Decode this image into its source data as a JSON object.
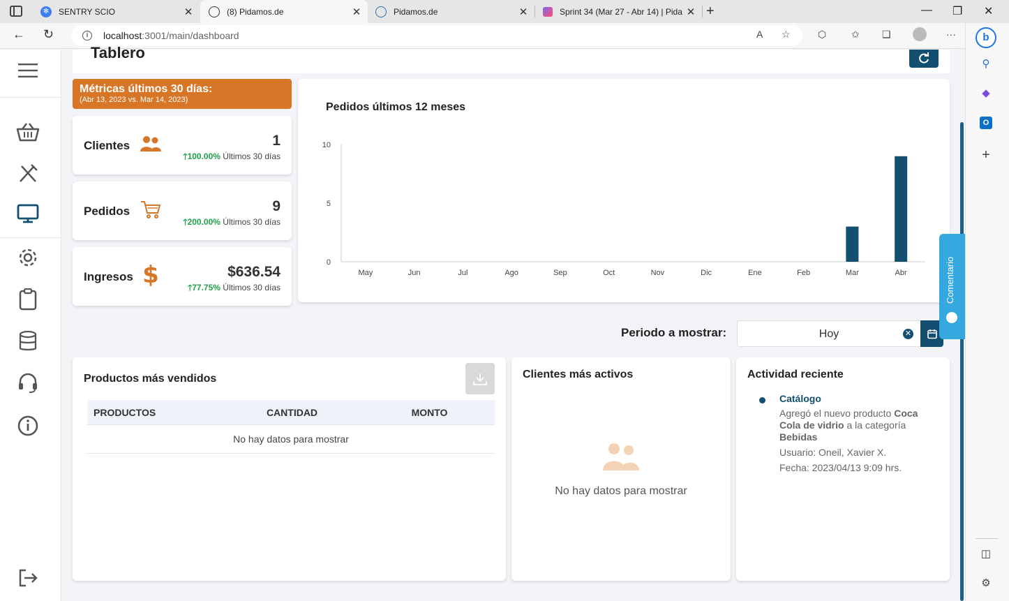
{
  "browser": {
    "tabs": [
      {
        "title": "SENTRY SCIO",
        "favicon": "gear-globe-icon"
      },
      {
        "title": "(8) Pidamos.de",
        "favicon": "pidamos-icon"
      },
      {
        "title": "Pidamos.de",
        "favicon": "pidamos-icon"
      },
      {
        "title": "Sprint 34 (Mar 27 - Abr 14) | Pida",
        "favicon": "clickup-icon"
      }
    ],
    "url_host": "localhost",
    "url_rest": ":3001/main/dashboard"
  },
  "page": {
    "title": "Tablero"
  },
  "metrics": {
    "banner_title": "Métricas últimos 30 días:",
    "banner_range": "(Abr 13, 2023 vs. Mar 14, 2023)",
    "items": [
      {
        "label": "Clientes",
        "value": "1",
        "pct": "100.00%",
        "trend_text": "Últimos 30 días",
        "icon": "users-icon"
      },
      {
        "label": "Pedidos",
        "value": "9",
        "pct": "200.00%",
        "trend_text": "Últimos 30 días",
        "icon": "cart-icon"
      },
      {
        "label": "Ingresos",
        "value": "$636.54",
        "pct": "77.75%",
        "trend_text": "Últimos 30 días",
        "icon": "dollar-icon"
      }
    ]
  },
  "chart_data": {
    "type": "bar",
    "title": "Pedidos últimos 12 meses",
    "categories": [
      "May",
      "Jun",
      "Jul",
      "Ago",
      "Sep",
      "Oct",
      "Nov",
      "Dic",
      "Ene",
      "Feb",
      "Mar",
      "Abr"
    ],
    "values": [
      0,
      0,
      0,
      0,
      0,
      0,
      0,
      0,
      0,
      0,
      3,
      9
    ],
    "ylim": [
      0,
      10
    ],
    "yticks": [
      0,
      5,
      10
    ],
    "bar_color": "#124f70",
    "grid": false
  },
  "period": {
    "label": "Periodo a mostrar:",
    "value": "Hoy"
  },
  "feedback": {
    "label": "Comentario"
  },
  "products": {
    "title": "Productos más vendidos",
    "columns": [
      "PRODUCTOS",
      "CANTIDAD",
      "MONTO"
    ],
    "empty": "No hay datos para mostrar"
  },
  "clients": {
    "title": "Clientes más activos",
    "empty": "No hay datos para mostrar"
  },
  "activity": {
    "title": "Actividad reciente",
    "category": "Catálogo",
    "desc_pre": "Agregó el nuevo producto ",
    "desc_product": "Coca Cola de vidrio",
    "desc_mid": " a la categoría ",
    "desc_category": "Bebidas",
    "user": "Usuario: Oneil, Xavier X.",
    "date": "Fecha: 2023/04/13 9:09 hrs."
  },
  "colors": {
    "brand_dark": "#124f70",
    "brand_orange": "#d67626",
    "trend_green": "#22a04b",
    "feedback_blue": "#35a8e0"
  }
}
